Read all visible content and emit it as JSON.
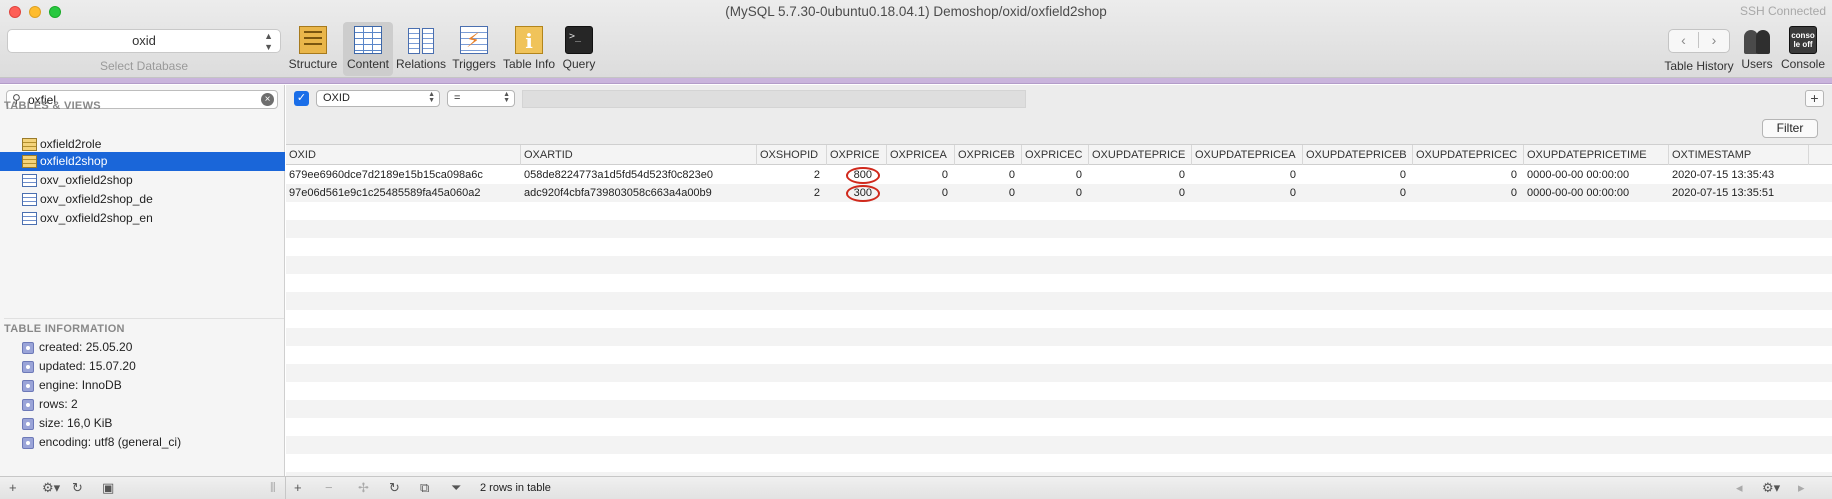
{
  "window": {
    "title": "(MySQL 5.7.30-0ubuntu0.18.04.1) Demoshop/oxid/oxfield2shop",
    "ssh_status": "SSH Connected"
  },
  "toolbar": {
    "database_value": "oxid",
    "database_caption": "Select Database",
    "buttons": [
      {
        "label": "Structure",
        "icon": "structure-icon"
      },
      {
        "label": "Content",
        "icon": "content-icon",
        "active": true
      },
      {
        "label": "Relations",
        "icon": "relations-icon"
      },
      {
        "label": "Triggers",
        "icon": "triggers-icon"
      },
      {
        "label": "Table Info",
        "icon": "table-info-icon"
      },
      {
        "label": "Query",
        "icon": "query-icon"
      }
    ],
    "right_buttons": [
      {
        "label": "Table History",
        "icon": "history-nav-icon"
      },
      {
        "label": "Users",
        "icon": "users-icon"
      },
      {
        "label": "Console",
        "icon": "console-icon",
        "icon_text": "conso le off"
      }
    ],
    "accent_color": "#c9b4dc"
  },
  "sidebar": {
    "search_value": "oxfiel",
    "tables_heading": "TABLES & VIEWS",
    "tables": [
      {
        "name": "oxfield2role",
        "kind": "table"
      },
      {
        "name": "oxfield2shop",
        "kind": "table",
        "selected": true
      },
      {
        "name": "oxv_oxfield2shop",
        "kind": "view"
      },
      {
        "name": "oxv_oxfield2shop_de",
        "kind": "view"
      },
      {
        "name": "oxv_oxfield2shop_en",
        "kind": "view"
      }
    ],
    "info_heading": "TABLE INFORMATION",
    "info": [
      "created: 25.05.20",
      "updated: 15.07.20",
      "engine: InnoDB",
      "rows: 2",
      "size: 16,0 KiB",
      "encoding: utf8 (general_ci)"
    ],
    "selection_color": "#1a66d9"
  },
  "filter": {
    "enabled": true,
    "field": "OXID",
    "operator": "=",
    "value": "",
    "filter_button": "Filter",
    "add_button": "+"
  },
  "grid": {
    "columns": [
      "OXID",
      "OXARTID",
      "OXSHOPID",
      "OXPRICE",
      "OXPRICEA",
      "OXPRICEB",
      "OXPRICEC",
      "OXUPDATEPRICE",
      "OXUPDATEPRICEA",
      "OXUPDATEPRICEB",
      "OXUPDATEPRICEC",
      "OXUPDATEPRICETIME",
      "OXTIMESTAMP"
    ],
    "rows": [
      [
        "679ee6960dce7d2189e15b15ca098a6c",
        "058de8224773a1d5fd54d523f0c823e0",
        "2",
        "800",
        "0",
        "0",
        "0",
        "0",
        "0",
        "0",
        "0",
        "0000-00-00 00:00:00",
        "2020-07-15 13:35:43"
      ],
      [
        "97e06d561e9c1c25485589fa45a060a2",
        "adc920f4cbfa739803058c663a4a00b9",
        "2",
        "300",
        "0",
        "0",
        "0",
        "0",
        "0",
        "0",
        "0",
        "0000-00-00 00:00:00",
        "2020-07-15 13:35:51"
      ]
    ],
    "highlight_color": "#d0291c"
  },
  "status": {
    "row_count": "2 rows in table"
  }
}
